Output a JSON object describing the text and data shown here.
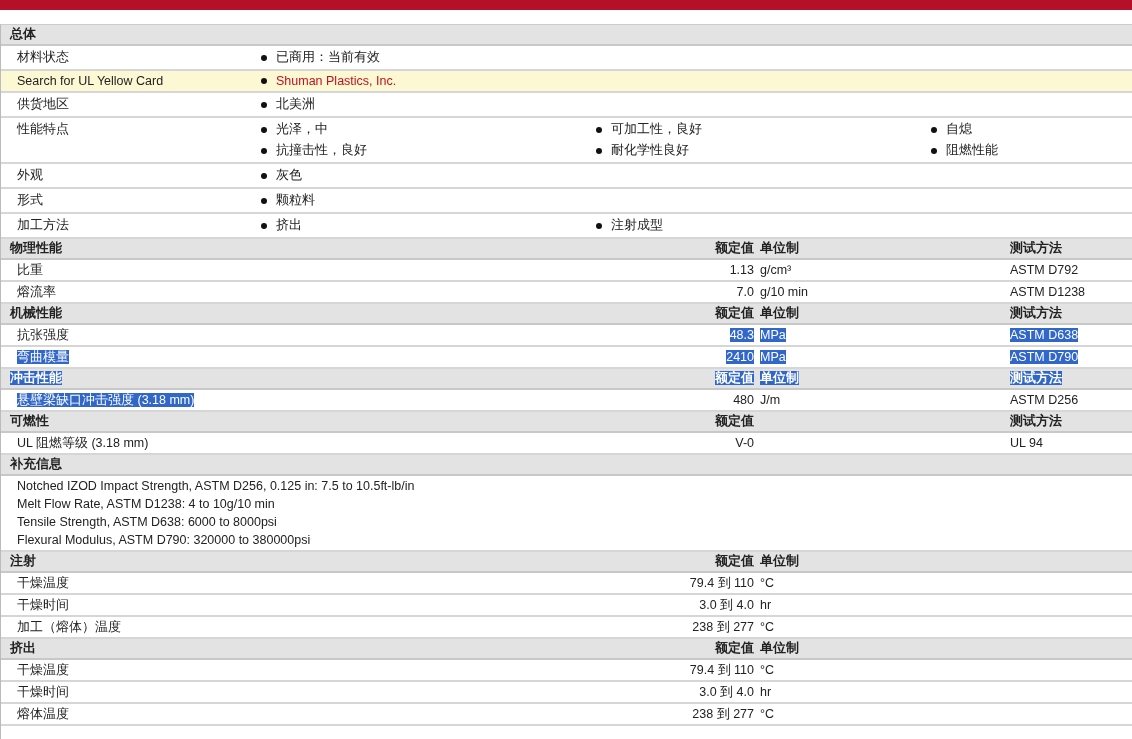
{
  "general": {
    "title": "总体",
    "rows": [
      {
        "label": "材料状态",
        "kind": "plain",
        "items": [
          "已商用：当前有效"
        ]
      },
      {
        "label": "Search for UL Yellow Card",
        "kind": "link",
        "items": [
          "Shuman Plastics, Inc."
        ]
      },
      {
        "label": "供货地区",
        "kind": "plain",
        "items": [
          "北美洲"
        ]
      },
      {
        "label": "性能特点",
        "kind": "plain",
        "items": [
          "光泽，中",
          "可加工性，良好",
          "自熄",
          "抗撞击性，良好",
          "耐化学性良好",
          "阻燃性能"
        ]
      },
      {
        "label": "外观",
        "kind": "plain",
        "items": [
          "灰色"
        ]
      },
      {
        "label": "形式",
        "kind": "plain",
        "items": [
          "颗粒料"
        ]
      },
      {
        "label": "加工方法",
        "kind": "plain",
        "items": [
          "挤出",
          "注射成型"
        ]
      }
    ]
  },
  "sections": [
    {
      "title": "物理性能",
      "value_heading": "额定值",
      "unit_heading": "单位制",
      "method_heading": "测试方法",
      "selected": false,
      "rows": [
        {
          "name": "比重",
          "value": "1.13",
          "unit": "g/cm³",
          "method": "ASTM D792",
          "name_selected": false,
          "data_selected": false
        },
        {
          "name": "熔流率",
          "value": "7.0",
          "unit": "g/10 min",
          "method": "ASTM D1238",
          "name_selected": false,
          "data_selected": false
        }
      ]
    },
    {
      "title": "机械性能",
      "value_heading": "额定值",
      "unit_heading": "单位制",
      "method_heading": "测试方法",
      "selected": false,
      "rows": [
        {
          "name": "抗张强度",
          "value": "48.3",
          "unit": "MPa",
          "method": "ASTM D638",
          "name_selected": false,
          "data_selected": true
        },
        {
          "name": "弯曲模量",
          "value": "2410",
          "unit": "MPa",
          "method": "ASTM D790",
          "name_selected": true,
          "data_selected": true
        }
      ]
    },
    {
      "title": "冲击性能",
      "value_heading": "额定值",
      "unit_heading": "单位制",
      "method_heading": "测试方法",
      "selected": true,
      "rows": [
        {
          "name": "悬壁梁缺口冲击强度 (3.18 mm)",
          "value": "480",
          "unit": "J/m",
          "method": "ASTM D256",
          "name_selected": true,
          "data_selected": false
        }
      ]
    },
    {
      "title": "可燃性",
      "value_heading": "额定值",
      "method_heading": "测试方法",
      "selected": false,
      "rows": [
        {
          "name": "UL 阻燃等级 (3.18 mm)",
          "value": "V-0",
          "method": "UL 94",
          "name_selected": false,
          "data_selected": false
        }
      ]
    }
  ],
  "supplement": {
    "title": "补充信息",
    "lines": [
      "Notched IZOD Impact Strength, ASTM D256, 0.125 in: 7.5 to 10.5ft-lb/in",
      "Melt Flow Rate, ASTM D1238: 4 to 10g/10 min",
      "Tensile Strength, ASTM D638: 6000 to 8000psi",
      "Flexural Modulus, ASTM D790: 320000 to 380000psi"
    ]
  },
  "processing": [
    {
      "title": "注射",
      "value_heading": "额定值",
      "unit_heading": "单位制",
      "selected": false,
      "rows": [
        {
          "name": "干燥温度",
          "value": "79.4 到  110",
          "unit": "°C",
          "name_selected": false,
          "data_selected": false
        },
        {
          "name": "干燥时间",
          "value": "3.0 到  4.0",
          "unit": "hr",
          "name_selected": false,
          "data_selected": false
        },
        {
          "name": "加工（熔体）温度",
          "value": "238 到  277",
          "unit": "°C",
          "name_selected": false,
          "data_selected": false
        }
      ]
    },
    {
      "title": "挤出",
      "value_heading": "额定值",
      "unit_heading": "单位制",
      "selected": false,
      "rows": [
        {
          "name": "干燥温度",
          "value": "79.4 到  110",
          "unit": "°C",
          "name_selected": false,
          "data_selected": false
        },
        {
          "name": "干燥时间",
          "value": "3.0 到  4.0",
          "unit": "hr",
          "name_selected": false,
          "data_selected": false
        },
        {
          "name": "熔体温度",
          "value": "238 到  277",
          "unit": "°C",
          "name_selected": false,
          "data_selected": false
        }
      ]
    }
  ]
}
